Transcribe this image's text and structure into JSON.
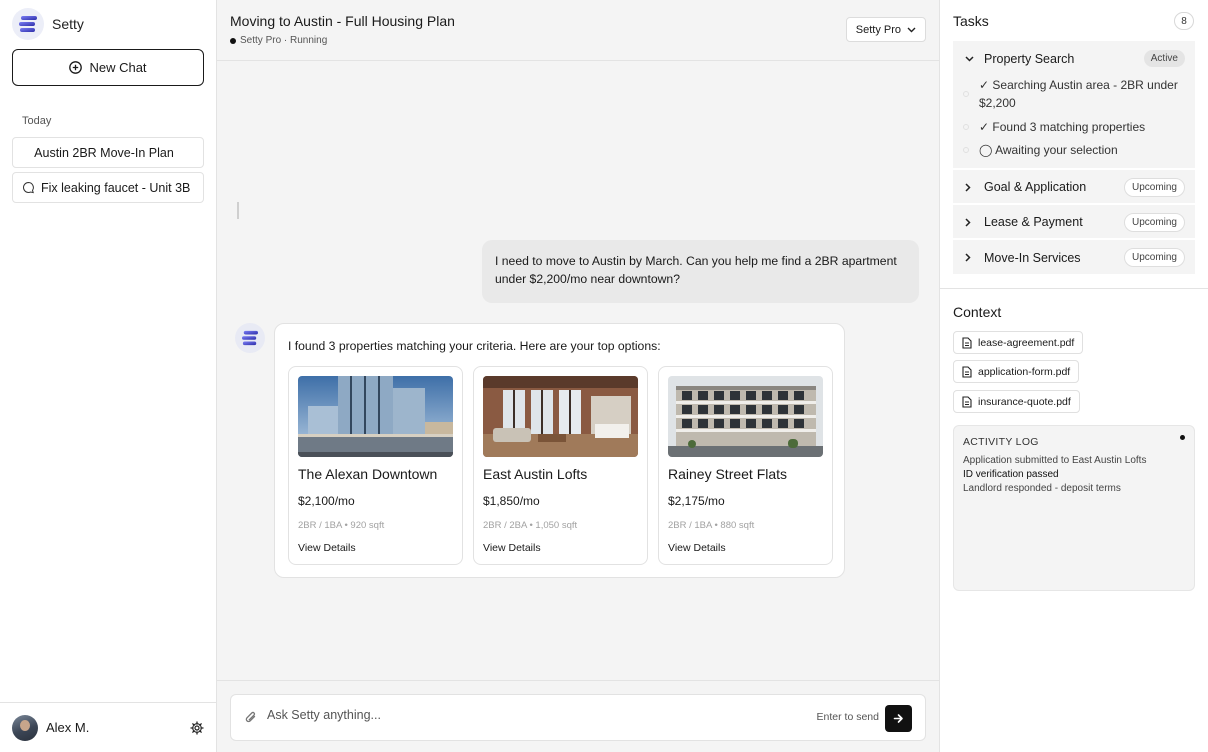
{
  "app": {
    "name": "Setty"
  },
  "sidebar": {
    "new_chat_label": "New Chat",
    "section_label": "Today",
    "chats": [
      {
        "label": "Austin 2BR Move-In Plan"
      },
      {
        "label": "Fix leaking faucet - Unit 3B",
        "icon": "chat-bubble-icon"
      }
    ],
    "user": {
      "name": "Alex M."
    }
  },
  "conversation": {
    "title": "Moving to Austin - Full Housing Plan",
    "status": "Setty Pro · Running",
    "model_selector": "Setty Pro",
    "user_message": "I need to move to Austin by March. Can you help me find a 2BR apartment under $2,200/mo near downtown?",
    "assistant_intro": "I found 3 properties matching your criteria. Here are your top options:",
    "properties": [
      {
        "name": "The Alexan Downtown",
        "price": "$2,100/mo",
        "meta": "2BR / 1BA • 920 sqft",
        "link": "View Details"
      },
      {
        "name": "East Austin Lofts",
        "price": "$1,850/mo",
        "meta": "2BR / 2BA • 1,050 sqft",
        "link": "View Details"
      },
      {
        "name": "Rainey Street Flats",
        "price": "$2,175/mo",
        "meta": "2BR / 1BA • 880 sqft",
        "link": "View Details"
      }
    ]
  },
  "composer": {
    "placeholder": "Ask Setty anything...",
    "hint": "Enter to send"
  },
  "tasks": {
    "title": "Tasks",
    "count": "8",
    "groups": [
      {
        "title": "Property Search",
        "status": "Active",
        "expanded": true,
        "subtasks": [
          "✓ Searching Austin area - 2BR under $2,200",
          "✓ Found 3 matching properties",
          "◯ Awaiting your selection"
        ]
      },
      {
        "title": "Goal & Application",
        "status": "Upcoming",
        "expanded": false
      },
      {
        "title": "Lease & Payment",
        "status": "Upcoming",
        "expanded": false
      },
      {
        "title": "Move-In Services",
        "status": "Upcoming",
        "expanded": false
      }
    ]
  },
  "context": {
    "title": "Context",
    "files": [
      "lease-agreement.pdf",
      "application-form.pdf",
      "insurance-quote.pdf"
    ],
    "activity_log": {
      "title": "ACTIVITY LOG",
      "entries": [
        "Application submitted to East Austin Lofts",
        "ID verification passed",
        "Landlord responded - deposit terms"
      ]
    }
  },
  "colors": {
    "brand_gradient_start": "#6d6ff0",
    "brand_gradient_end": "#2d2ea8",
    "accent_dark": "#111111"
  }
}
